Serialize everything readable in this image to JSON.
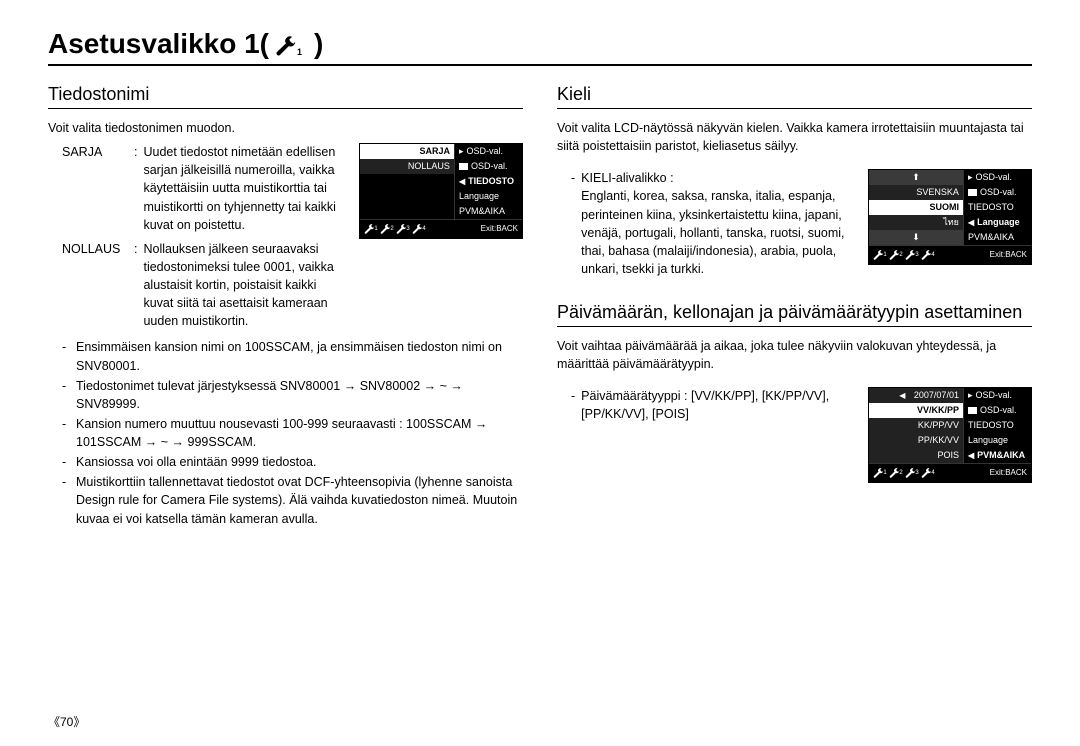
{
  "page_number": "《70》",
  "title_prefix": "Asetusvalikko 1(",
  "title_suffix": ")",
  "left": {
    "heading": "Tiedostonimi",
    "intro": "Voit valita tiedostonimen muodon.",
    "def1_key": "SARJA",
    "def1_sep": ":",
    "def1_txt": "Uudet tiedostot nimetään edellisen sarjan jälkeisillä numeroilla, vaikka käytettäisiin uutta muistikorttia tai muistikortti on tyhjennetty tai kaikki kuvat on poistettu.",
    "def2_key": "NOLLAUS",
    "def2_sep": ":",
    "def2_txt": "Nollauksen jälkeen seuraavaksi tiedostonimeksi tulee 0001, vaikka alustaisit kortin, poistaisit kaikki kuvat siitä tai asettaisit kameraan uuden muistikortin.",
    "b1": "Ensimmäisen kansion nimi on 100SSCAM, ja ensimmäisen tiedoston nimi on SNV80001.",
    "b2": "Tiedostonimet tulevat järjestyksessä SNV80001 → SNV80002 → ~ → SNV89999.",
    "b3": "Kansion numero muuttuu nousevasti 100-999 seuraavasti : 100SSCAM → 101SSCAM → ~ → 999SSCAM.",
    "b4": "Kansiossa voi olla enintään 9999 tiedostoa.",
    "b5": "Muistikorttiin tallennettavat tiedostot ovat DCF-yhteensopivia (lyhenne sanoista Design rule for Camera File systems). Älä vaihda kuvatiedoston nimeä. Muutoin kuvaa ei voi katsella tämän kameran avulla."
  },
  "right1": {
    "heading": "Kieli",
    "intro": "Voit valita LCD-näytössä näkyvän kielen. Vaikka kamera irrotettaisiin muuntajasta tai siitä poistettaisiin paristot, kieliasetus säilyy.",
    "sub_label": "KIELI-alivalikko :",
    "sub_txt": "Englanti, korea, saksa, ranska, italia, espanja, perinteinen kiina, yksinkertaistettu kiina, japani, venäjä, portugali, hollanti, tanska, ruotsi, suomi, thai, bahasa (malaiji/indonesia), arabia, puola, unkari, tsekki ja turkki."
  },
  "right2": {
    "heading": "Päivämäärän, kellonajan ja päivämäärätyypin asettaminen",
    "intro": "Voit vaihtaa päivämäärää ja aikaa, joka tulee näkyviin valokuvan yhteydessä, ja määrittää päivämäärätyypin.",
    "sub_label": "Päivämäärätyyppi :",
    "sub_txt": "[VV/KK/PP], [KK/PP/VV], [PP/KK/VV], [POIS]"
  },
  "lcd_common": {
    "exit": "Exit:BACK",
    "r1": "OSD-val.",
    "r2": "OSD-val.",
    "r3": "TIEDOSTO",
    "r4": "Language",
    "r5": "PVM&AIKA"
  },
  "lcd1": {
    "l1": "SARJA",
    "l2": "NOLLAUS"
  },
  "lcd2": {
    "l1": "⬆",
    "l2": "SVENSKA",
    "l3": "SUOMI",
    "l4": "ไทย",
    "l5": "⬇"
  },
  "lcd3": {
    "l1": "2007/07/01",
    "l2": "VV/KK/PP",
    "l3": "KK/PP/VV",
    "l4": "PP/KK/VV",
    "l5": "POIS"
  }
}
